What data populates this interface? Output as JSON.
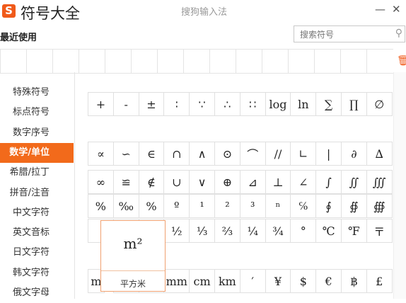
{
  "app": {
    "logo_letter": "S",
    "title": "符号大全",
    "subtitle": "搜狗输入法",
    "minimize": "—",
    "close": "✕"
  },
  "recent_label": "最近使用",
  "search": {
    "placeholder": "搜索符号",
    "icon": "magnifier"
  },
  "categories": [
    "特殊符号",
    "标点符号",
    "数字序号",
    "数学/单位",
    "希腊/拉丁",
    "拼音/注音",
    "中文字符",
    "英文音标",
    "日文字符",
    "韩文字符",
    "俄文字母"
  ],
  "active_category": "数学/单位",
  "symbol_rows": [
    [
      "+",
      "-",
      "±",
      "∶",
      "∵",
      "∴",
      "∷",
      "log",
      "ln",
      "∑",
      "∏",
      "∅"
    ],
    [],
    [
      "∝",
      "∽",
      "∈",
      "∩",
      "∧",
      "⊙",
      "⌒",
      "//",
      "∟",
      "|",
      "∂",
      "∆"
    ],
    [
      "∞",
      "≌",
      "∉",
      "∪",
      "∨",
      "⊕",
      "⊿",
      "⊥",
      "∠",
      "∫",
      "∬",
      "∭"
    ],
    [
      "%",
      "‰",
      "%",
      "º",
      "¹",
      "²",
      "³",
      "ⁿ",
      "℅",
      "∮",
      "∯",
      "∰"
    ],
    [
      "",
      "",
      "",
      "½",
      "⅓",
      "⅔",
      "¼",
      "¾",
      "°",
      "℃",
      "℉",
      "〒"
    ],
    [],
    [
      "m",
      "",
      "",
      "mm",
      "cm",
      "km",
      "′",
      "¥",
      "$",
      "€",
      "฿",
      "£"
    ]
  ],
  "tooltip": {
    "symbol": "m²",
    "name": "平方米"
  },
  "accent_color": "#f26a1b"
}
